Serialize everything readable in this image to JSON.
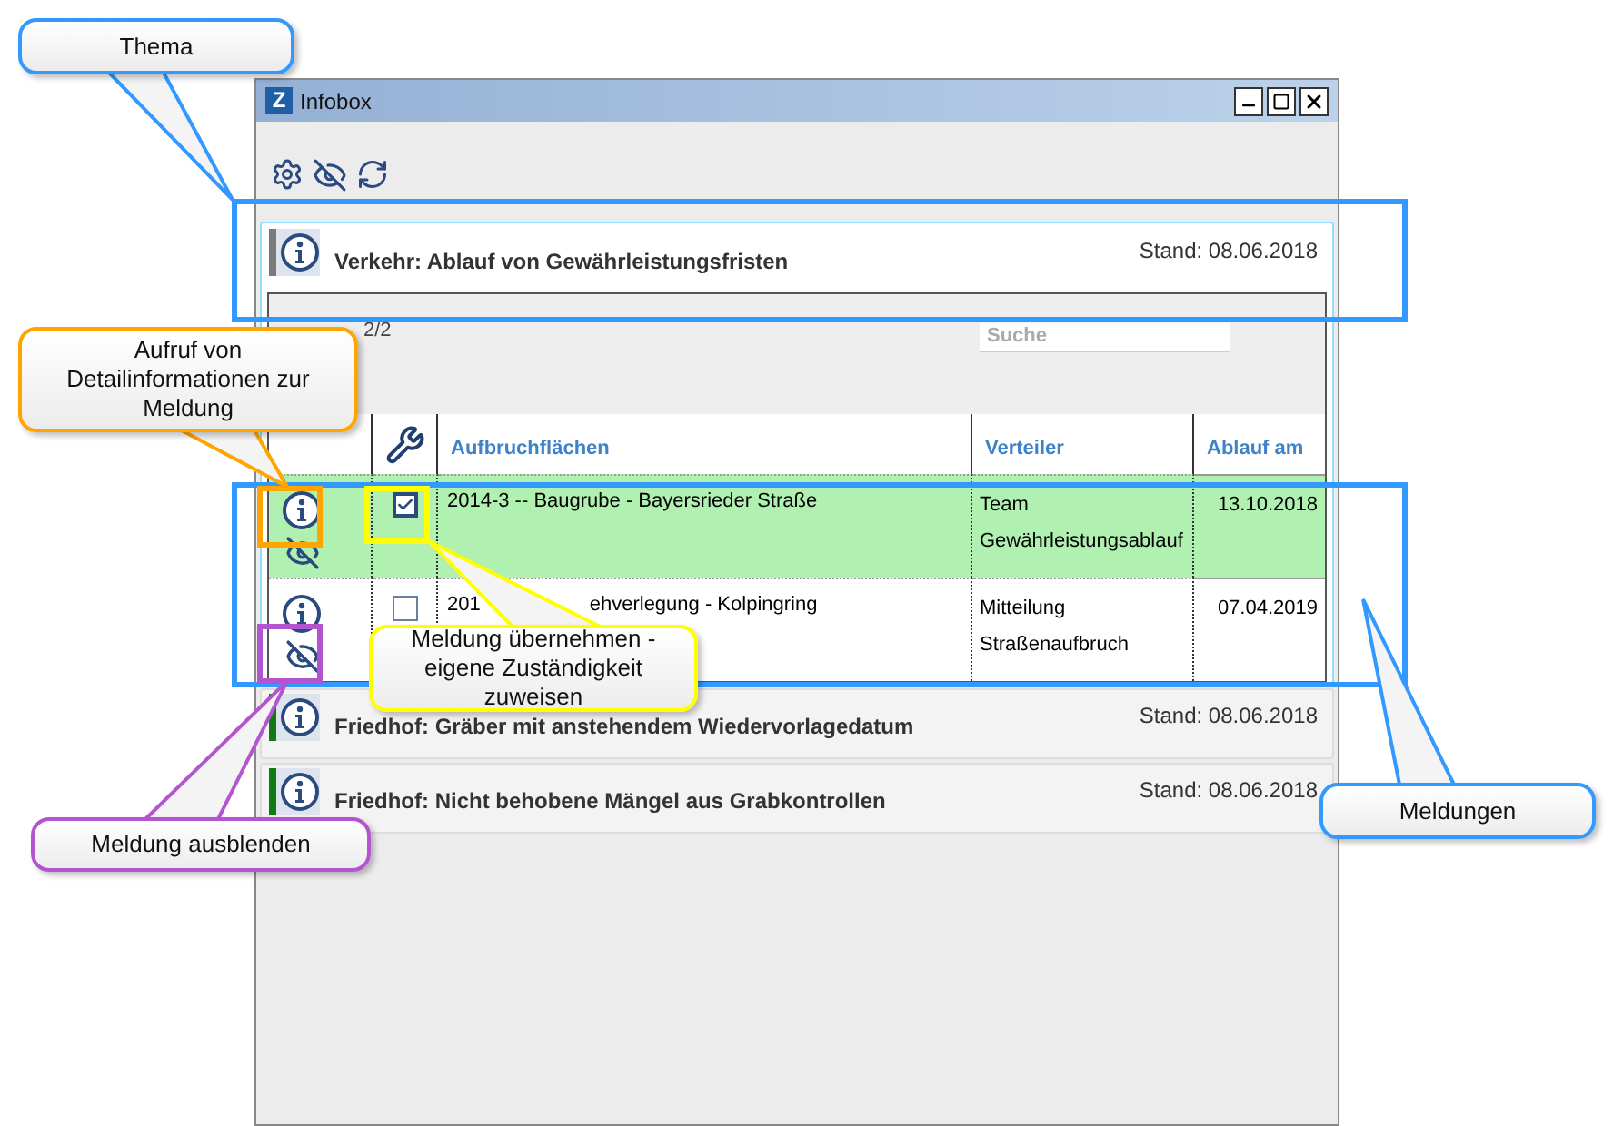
{
  "window": {
    "title": "Infobox",
    "logo": "Z"
  },
  "themes": [
    {
      "title": "Verkehr: Ablauf von Gewährleistungsfristen",
      "date": "Stand: 08.06.2018",
      "color": "#7a7a7a",
      "expanded": true,
      "counter": "2/2",
      "search": {
        "placeholder": "Suche"
      },
      "columns": [
        "Aufbruchflächen",
        "Verteiler",
        "Ablauf am"
      ],
      "rows": [
        {
          "title_start": "2014-3 -- Baugrube - Bayersrieder Straße",
          "title_end": "",
          "distributor": [
            "Team",
            "Gewährleistungsablauf"
          ],
          "due": "13.10.2018",
          "checked": true,
          "selected": true
        },
        {
          "title_start": "201",
          "title_end": "ehverlegung - Kolpingring",
          "distributor": [
            "Mitteilung",
            "Straßenaufbruch"
          ],
          "due": "07.04.2019",
          "checked": false,
          "selected": false
        }
      ]
    },
    {
      "title": "Friedhof: Gräber mit anstehendem Wiedervorlagedatum",
      "date": "Stand: 08.06.2018",
      "color": "#127a12",
      "expanded": false
    },
    {
      "title": "Friedhof: Nicht behobene Mängel aus Grabkontrollen",
      "date": "Stand: 08.06.2018",
      "color": "#127a12",
      "expanded": false
    }
  ],
  "annotations": [
    {
      "text": "Thema",
      "color": "#3399ff"
    },
    {
      "text": "Aufruf von Detailinformationen zur Meldung",
      "color": "#ffa500"
    },
    {
      "text": "Meldung übernehmen - eigene Zuständigkeit zuweisen",
      "color": "#ffff00"
    },
    {
      "text": "Meldung ausblenden",
      "color": "#b455d0"
    },
    {
      "text": "Meldungen",
      "color": "#3399ff"
    }
  ]
}
